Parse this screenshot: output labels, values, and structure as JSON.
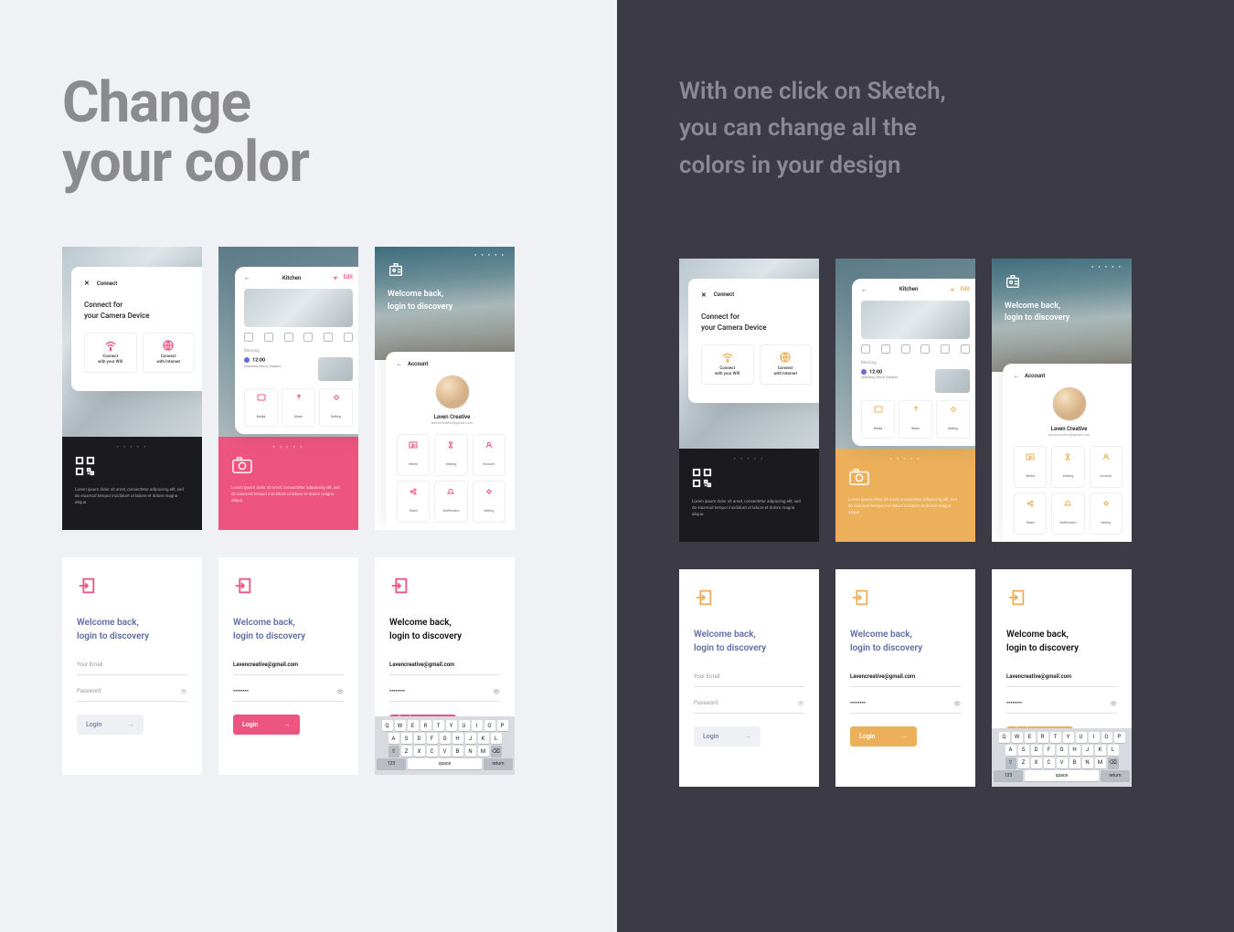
{
  "left": {
    "headline_1": "Change",
    "headline_2": "your color"
  },
  "right": {
    "sub_1": "With one click on Sketch,",
    "sub_2": "you can change all the",
    "sub_3": "colors in your design"
  },
  "colors": {
    "pink": "#ed5580",
    "orange": "#ecb05a"
  },
  "connect": {
    "title": "Connect",
    "sub1": "Connect for",
    "sub2": "your Camera Device",
    "opt1a": "Connect",
    "opt1b": "with your Wifi",
    "opt2a": "Connect",
    "opt2b": "with Internet",
    "lorem": "Lorem ipsum dolor sit amet, consectetur adipiscing elit, sed do eiusmod tempor incididunt ut labore et dolore magna aliqua."
  },
  "kitchen": {
    "title": "Kitchen",
    "edit": "Edit",
    "section": "Morning",
    "time": "12:00",
    "task": "Washing Move Studies",
    "tile1": "Media",
    "tile2": "Share",
    "tile3": "Setting"
  },
  "welcome": {
    "line1": "Welcome back,",
    "line2": "login to discovery"
  },
  "account": {
    "title": "Account",
    "name": "Laven Creative",
    "mail": "lavencreative@gmail.com",
    "g": [
      "Media",
      "Waiting",
      "Account",
      "Share",
      "Notification",
      "Setting"
    ]
  },
  "login": {
    "welcome1": "Welcome back,",
    "welcome2": "login to discovery",
    "email_ph": "Your Email",
    "email_val": "Lavencreative@gmail.com",
    "pass_ph": "Password",
    "pass_val": "••••••••",
    "btn": "Login"
  },
  "kbd": {
    "r1": [
      "Q",
      "W",
      "E",
      "R",
      "T",
      "Y",
      "U",
      "I",
      "O",
      "P"
    ],
    "r2": [
      "A",
      "S",
      "D",
      "F",
      "G",
      "H",
      "J",
      "K",
      "L"
    ],
    "r3": [
      "Z",
      "X",
      "C",
      "V",
      "B",
      "N",
      "M"
    ],
    "shift": "⇧",
    "del": "⌫",
    "num": "123",
    "space": "space",
    "ret": "return"
  }
}
